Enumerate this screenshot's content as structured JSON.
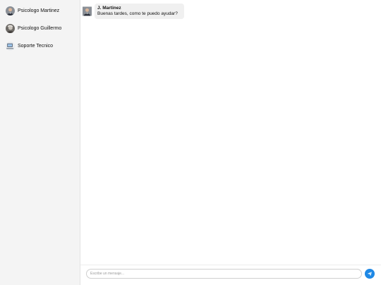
{
  "sidebar": {
    "contacts": [
      {
        "name": "Psicologo Martinez",
        "avatar": "man-photo-avatar"
      },
      {
        "name": "Psicologo Guillermo",
        "avatar": "elder-man-photo-avatar"
      },
      {
        "name": "Soporte Tecnico",
        "avatar": "computer-photo-avatar"
      }
    ]
  },
  "chat": {
    "messages": [
      {
        "sender": "J. Martinez",
        "text": "Buenas tardes, como te puedo ayudar?",
        "avatar": "man-photo-avatar"
      }
    ],
    "input": {
      "placeholder": "Escribe un mensaje...",
      "value": ""
    },
    "send_icon": "paper-plane-icon"
  },
  "colors": {
    "sidebar_bg": "#f4f4f4",
    "bubble_bg": "#f0f0f0",
    "send_button": "#1e88e5"
  }
}
